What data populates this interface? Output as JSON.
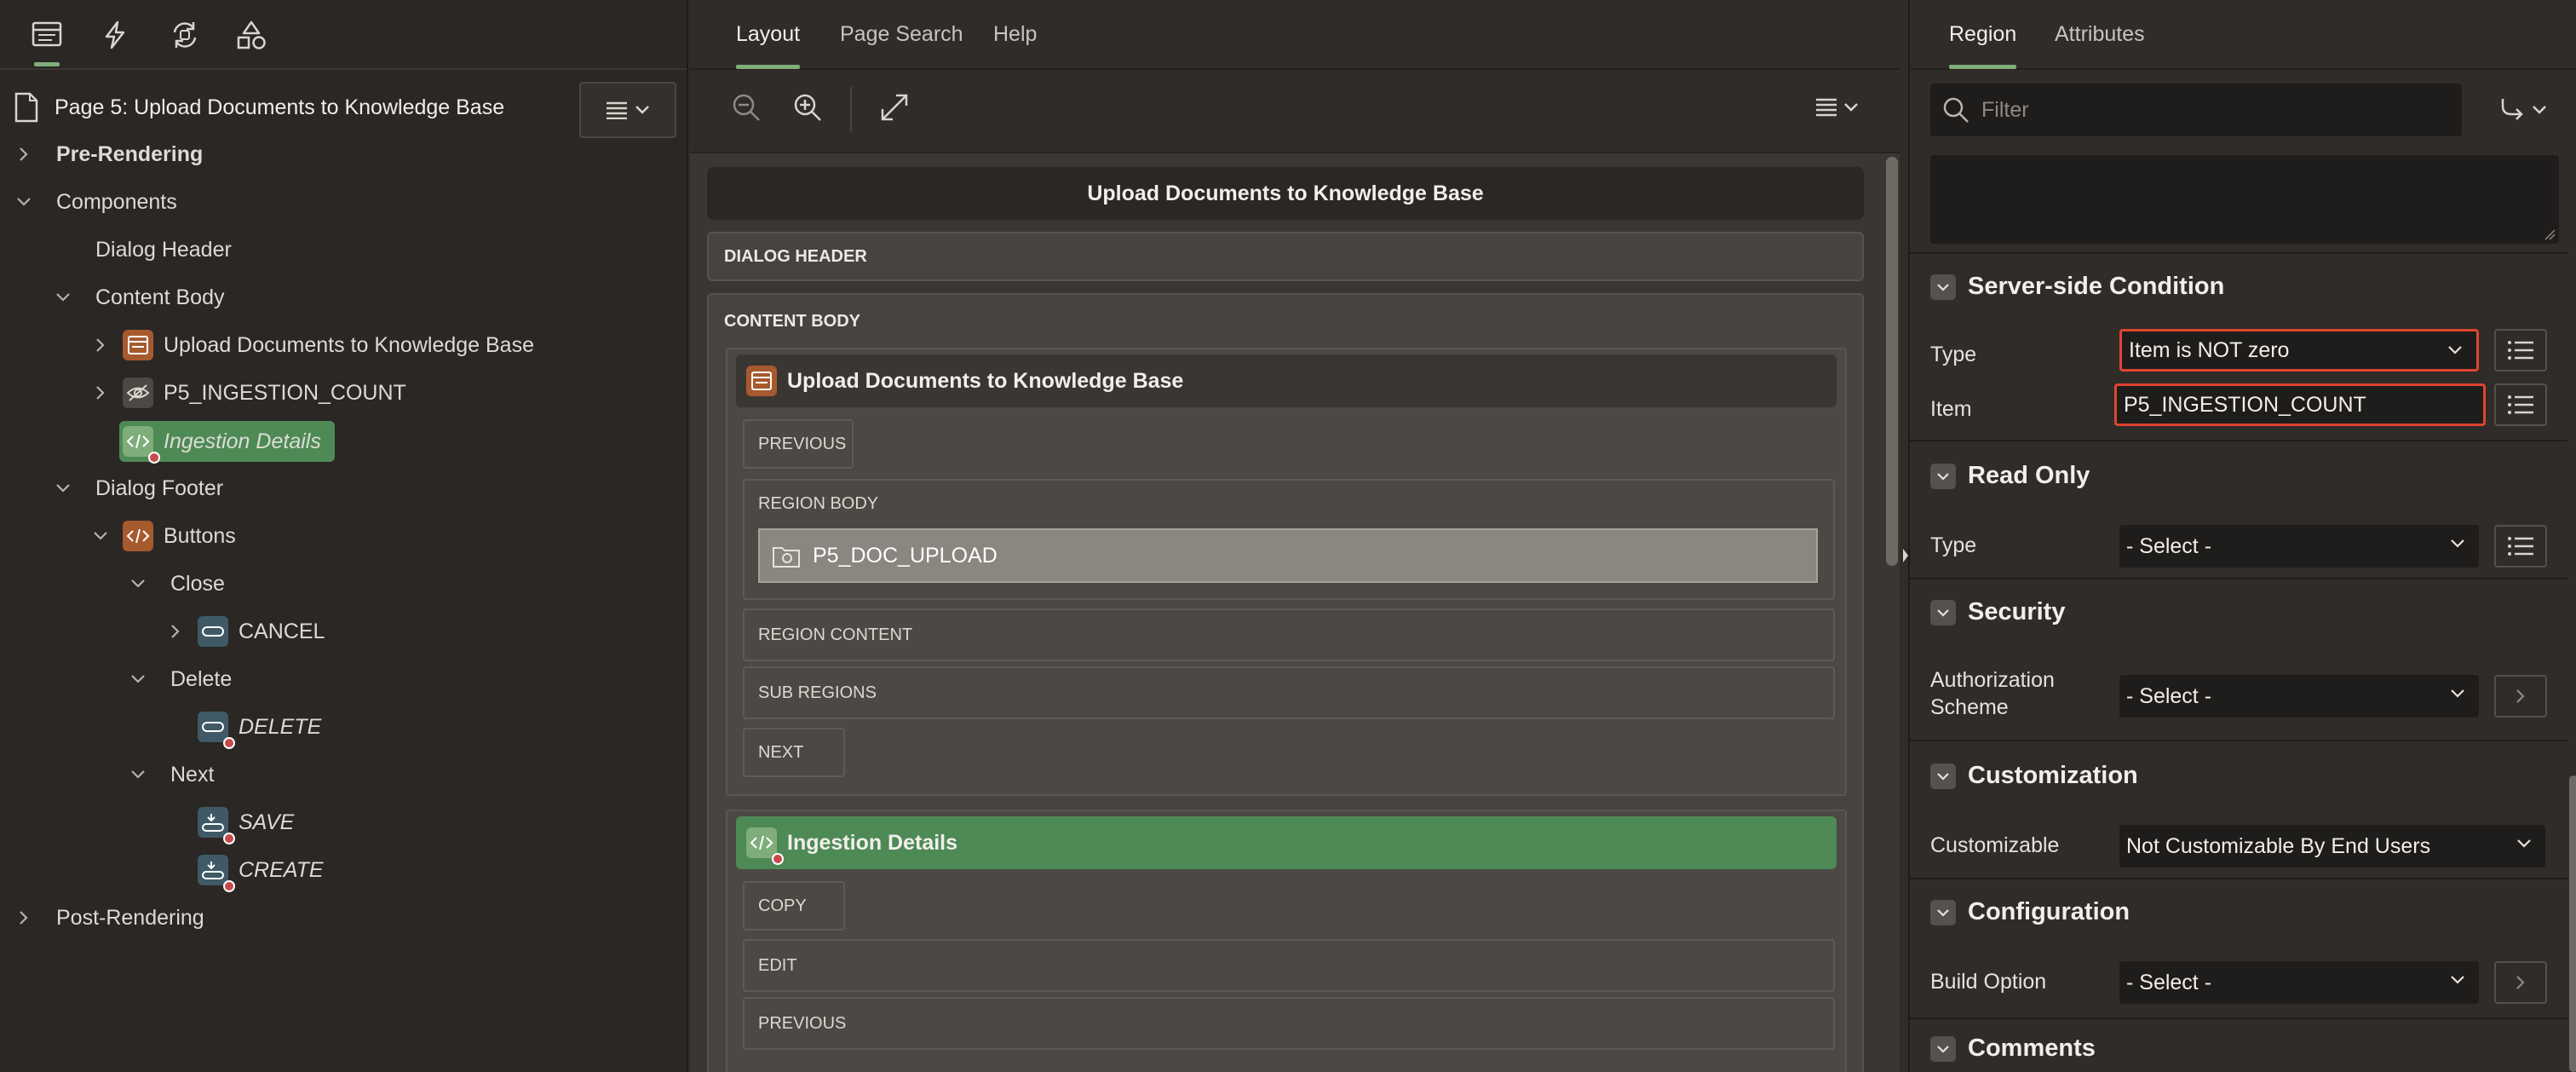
{
  "left": {
    "page_title": "Page 5: Upload Documents to Knowledge Base",
    "tree": {
      "pre_rendering": "Pre-Rendering",
      "components": "Components",
      "dialog_header": "Dialog Header",
      "content_body": "Content Body",
      "region_upload": "Upload Documents to Knowledge Base",
      "item_ingestion_count": "P5_INGESTION_COUNT",
      "region_ingestion_details": "Ingestion Details",
      "dialog_footer": "Dialog Footer",
      "buttons": "Buttons",
      "close": "Close",
      "cancel": "CANCEL",
      "delete_group": "Delete",
      "delete_btn": "DELETE",
      "next": "Next",
      "save": "SAVE",
      "create": "CREATE",
      "post_rendering": "Post-Rendering"
    }
  },
  "middle": {
    "tabs": [
      "Layout",
      "Page Search",
      "Help"
    ],
    "dialog_title": "Upload Documents to Knowledge Base",
    "dialog_header": "DIALOG HEADER",
    "content_body": "CONTENT BODY",
    "region1": {
      "title": "Upload Documents to Knowledge Base",
      "previous": "PREVIOUS",
      "region_body": "REGION BODY",
      "doc_upload": "P5_DOC_UPLOAD",
      "region_content": "REGION CONTENT",
      "sub_regions": "SUB REGIONS",
      "next": "NEXT"
    },
    "region2": {
      "title": "Ingestion Details",
      "copy": "COPY",
      "edit": "EDIT",
      "previous": "PREVIOUS"
    }
  },
  "right": {
    "tabs": [
      "Region",
      "Attributes"
    ],
    "filter_placeholder": "Filter",
    "server_side": {
      "title": "Server-side Condition",
      "type_label": "Type",
      "type_value": "Item is NOT zero",
      "item_label": "Item",
      "item_value": "P5_INGESTION_COUNT"
    },
    "read_only": {
      "title": "Read Only",
      "type_label": "Type",
      "type_value": "- Select -"
    },
    "security": {
      "title": "Security",
      "auth_label_1": "Authorization",
      "auth_label_2": "Scheme",
      "auth_value": "- Select -"
    },
    "customization": {
      "title": "Customization",
      "label": "Customizable",
      "value": "Not Customizable By End Users"
    },
    "configuration": {
      "title": "Configuration",
      "label": "Build Option",
      "value": "- Select -"
    },
    "comments": {
      "title": "Comments"
    }
  },
  "colors": {
    "accent_green": "#7fae7a",
    "region_green": "#4d8a55",
    "highlight_red": "#e0452f",
    "region_orange": "#a65a2e"
  }
}
